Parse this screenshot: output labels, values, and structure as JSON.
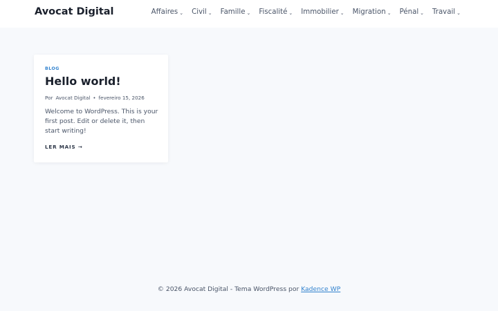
{
  "header": {
    "site_title": "Avocat Digital",
    "nav": [
      {
        "label": "Affaires"
      },
      {
        "label": "Civil"
      },
      {
        "label": "Famille"
      },
      {
        "label": "Fiscalité"
      },
      {
        "label": "Immobilier"
      },
      {
        "label": "Migration"
      },
      {
        "label": "Pénal"
      },
      {
        "label": "Travail"
      }
    ]
  },
  "post": {
    "category": "BLOG",
    "title": "Hello world!",
    "meta_prefix": "Por",
    "author": "Avocat Digital",
    "meta_sep": "•",
    "date": "fevereiro 15, 2026",
    "excerpt": "Welcome to WordPress. This is your first post. Edit or delete it, then start writing!",
    "read_more": "LER MAIS →"
  },
  "footer": {
    "text": "© 2026 Avocat Digital - Tema WordPress por",
    "link": "Kadence WP"
  },
  "colors": {
    "background": "#f7f9fc",
    "accent": "#3182ce"
  }
}
